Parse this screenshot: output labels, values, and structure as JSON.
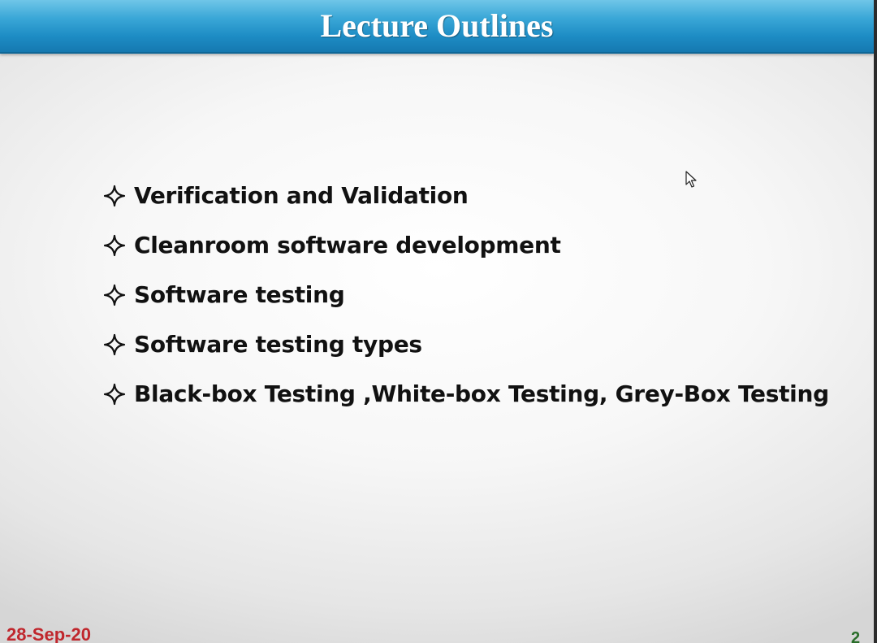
{
  "slide": {
    "title": "Lecture Outlines",
    "items": [
      {
        "label": "Verification and Validation"
      },
      {
        "label": "Cleanroom software development"
      },
      {
        "label": "Software testing"
      },
      {
        "label": "Software testing types"
      },
      {
        "label": "Black-box Testing ,White-box Testing, Grey-Box Testing"
      }
    ],
    "footer": {
      "date": "28-Sep-20",
      "page_number": "2"
    }
  },
  "colors": {
    "title_bar": "#1d8cc4",
    "title_text": "#ffffff",
    "item_text": "#111111",
    "date_text": "#c0272d",
    "page_number_text": "#2a6e2a"
  },
  "icons": {
    "bullet": "four-point-star-outline-icon",
    "cursor": "mouse-pointer-icon"
  }
}
